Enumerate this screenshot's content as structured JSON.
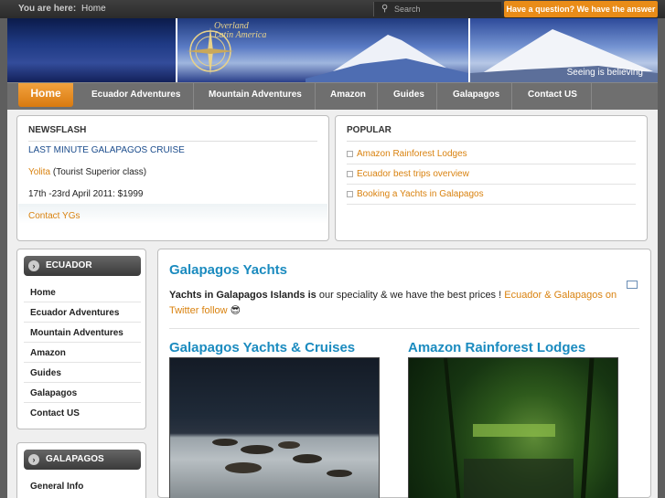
{
  "topbar": {
    "crumb_label": "You are here:",
    "crumb_home": "Home",
    "search_placeholder": "Search",
    "ask_button": "Have a question? We have the answer"
  },
  "banner": {
    "logo_line1": "Overland",
    "logo_line2": "Latin America",
    "tagline": "Seeing is believing"
  },
  "nav": {
    "home": "Home",
    "items": [
      "Ecuador Adventures",
      "Mountain Adventures",
      "Amazon",
      "Guides",
      "Galapagos",
      "Contact US"
    ]
  },
  "newsflash": {
    "title": "NEWSFLASH",
    "headline": "LAST MINUTE GALAPAGOS CRUISE",
    "yacht_link": "Yolita",
    "yacht_class": "(Tourist Superior class)",
    "dates_price": "17th -23rd April 2011: $1999",
    "contact_link": "Contact YGs"
  },
  "popular": {
    "title": "POPULAR",
    "items": [
      "Amazon Rainforest Lodges",
      "Ecuador best trips overview",
      "Booking a Yachts in Galapagos"
    ]
  },
  "sidebar_ecuador": {
    "title": "ECUADOR",
    "items": [
      "Home",
      "Ecuador Adventures",
      "Mountain Adventures",
      "Amazon",
      "Guides",
      "Galapagos",
      "Contact US"
    ]
  },
  "sidebar_galapagos": {
    "title": "GALAPAGOS",
    "items": [
      "General Info"
    ]
  },
  "content": {
    "title": "Galapagos Yachts",
    "intro_bold": "Yachts in Galapagos Islands is",
    "intro_text": " our speciality & we have the best prices ! ",
    "intro_link": "Ecuador & Galapagos on Twitter follow",
    "emoji": "😎",
    "sections": [
      "Galapagos Yachts & Cruises",
      "Amazon Rainforest Lodges"
    ]
  },
  "colors": {
    "accent_orange": "#e98c18",
    "title_blue": "#1b8bbf"
  }
}
